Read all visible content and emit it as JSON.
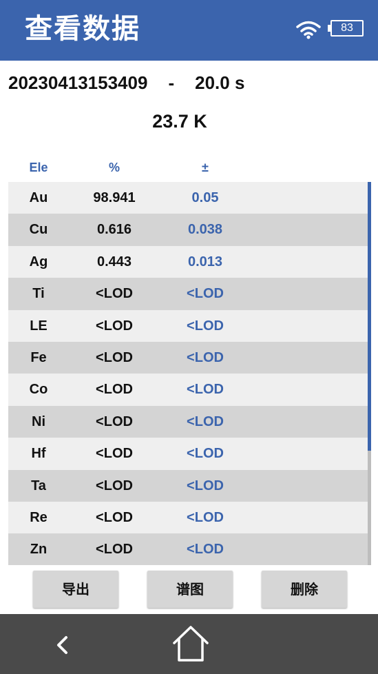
{
  "header": {
    "title": "查看数据",
    "battery": "83",
    "wifi_icon": "wifi-icon",
    "battery_icon": "battery-icon",
    "background_color": "#3b64ad"
  },
  "measurement": {
    "id": "20230413153409",
    "separator": "-",
    "duration": "20.0 s",
    "karat": "23.7 K"
  },
  "table": {
    "headers": {
      "element": "Ele",
      "percent": "%",
      "error": "±"
    },
    "rows": [
      {
        "element": "Au",
        "percent": "98.941",
        "error": "0.05"
      },
      {
        "element": "Cu",
        "percent": "0.616",
        "error": "0.038"
      },
      {
        "element": "Ag",
        "percent": "0.443",
        "error": "0.013"
      },
      {
        "element": "Ti",
        "percent": "<LOD",
        "error": "<LOD"
      },
      {
        "element": "LE",
        "percent": "<LOD",
        "error": "<LOD"
      },
      {
        "element": "Fe",
        "percent": "<LOD",
        "error": "<LOD"
      },
      {
        "element": "Co",
        "percent": "<LOD",
        "error": "<LOD"
      },
      {
        "element": "Ni",
        "percent": "<LOD",
        "error": "<LOD"
      },
      {
        "element": "Hf",
        "percent": "<LOD",
        "error": "<LOD"
      },
      {
        "element": "Ta",
        "percent": "<LOD",
        "error": "<LOD"
      },
      {
        "element": "Re",
        "percent": "<LOD",
        "error": "<LOD"
      },
      {
        "element": "Zn",
        "percent": "<LOD",
        "error": "<LOD"
      }
    ],
    "accent_color": "#3b64ad"
  },
  "actions": {
    "export_label": "导出",
    "spectrum_label": "谱图",
    "delete_label": "删除"
  },
  "navbar": {
    "back_icon": "back-chevron-icon",
    "home_icon": "home-icon"
  }
}
